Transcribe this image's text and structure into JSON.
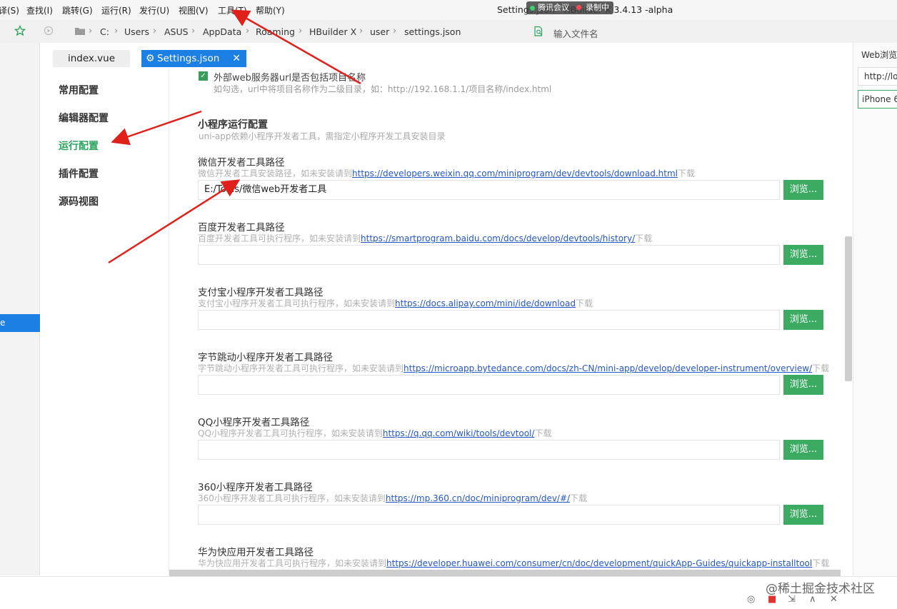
{
  "menu": {
    "items": [
      "译(S)",
      "查找(I)",
      "跳转(G)",
      "运行(R)",
      "发行(U)",
      "视图(V)",
      "工具(T)",
      "帮助(Y)"
    ],
    "window_title": "Settings.json - HBuilder X 3.4.13 -alpha",
    "meeting_badge": "腾讯会议",
    "recording": "录制中"
  },
  "address": {
    "crumbs": [
      "C:",
      "Users",
      "ASUS",
      "AppData",
      "Roaming",
      "HBuilder X",
      "user",
      "settings.json"
    ],
    "file_input_placeholder": "输入文件名"
  },
  "left_strip": {
    "selected_label": "e"
  },
  "tabs": {
    "index": "index.vue",
    "settings": "Settings.json"
  },
  "nav": {
    "items": [
      {
        "label": "常用配置",
        "active": false
      },
      {
        "label": "编辑器配置",
        "active": false
      },
      {
        "label": "运行配置",
        "active": true
      },
      {
        "label": "插件配置",
        "active": false
      },
      {
        "label": "源码视图",
        "active": false
      }
    ]
  },
  "content": {
    "top_check_label": "外部web服务器url是否包括项目名称",
    "top_check_hint": "如勾选，url中将项目名称作为二级目录，如：http://192.168.1.1/项目名称/index.html",
    "section_title": "小程序运行配置",
    "section_hint": "uni-app依赖小程序开发者工具，需指定小程序开发工具安装目录",
    "browse_label": "浏览...",
    "download_suffix": "下载",
    "fields": [
      {
        "label": "微信开发者工具路径",
        "hint": "微信开发者工具安装路径，如未安装请到",
        "link": "https://developers.weixin.qq.com/miniprogram/dev/devtools/download.html",
        "value": "E:/Tools/微信web开发者工具"
      },
      {
        "label": "百度开发者工具路径",
        "hint": "百度开发者工具可执行程序，如未安装请到",
        "link": "https://smartprogram.baidu.com/docs/develop/devtools/history/",
        "value": ""
      },
      {
        "label": "支付宝小程序开发者工具路径",
        "hint": "支付宝小程序开发者工具可执行程序，如未安装请到",
        "link": "https://docs.alipay.com/mini/ide/download",
        "value": ""
      },
      {
        "label": "字节跳动小程序开发者工具路径",
        "hint": "字节跳动小程序开发者工具可执行程序，如未安装请到",
        "link": "https://microapp.bytedance.com/docs/zh-CN/mini-app/develop/developer-instrument/overview/",
        "value": ""
      },
      {
        "label": "QQ小程序开发者工具路径",
        "hint": "QQ小程序开发者工具可执行程序，如未安装请到",
        "link": "https://q.qq.com/wiki/tools/devtool/",
        "value": ""
      },
      {
        "label": "360小程序开发者工具路径",
        "hint": "360小程序开发者工具可执行程序，如未安装请到",
        "link": "https://mp.360.cn/doc/miniprogram/dev/#/",
        "value": ""
      },
      {
        "label": "华为快应用开发者工具路径",
        "hint": "华为快应用开发者工具可执行程序，如未安装请到",
        "link": "https://developer.huawei.com/consumer/cn/doc/development/quickApp-Guides/quickapp-installtool",
        "value": ""
      }
    ]
  },
  "right_panel": {
    "title": "Web浏览器",
    "url": "http://lo",
    "device": "iPhone 6"
  },
  "status": {
    "watermark": "@稀土掘金技术社区"
  },
  "colors": {
    "accent_green": "#3bab62",
    "accent_blue": "#1b7fe3",
    "annotation_red": "#e0201b"
  }
}
